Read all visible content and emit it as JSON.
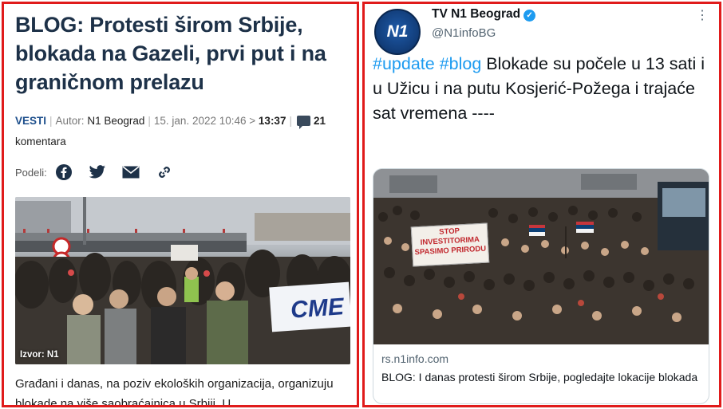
{
  "left": {
    "title": "BLOG: Protesti širom Srbije, blokada na Gazeli, prvi put i na graničnom prelazu",
    "meta": {
      "category": "VESTI",
      "author_label": "Autor:",
      "author": "N1 Beograd",
      "date": "15. jan. 2022 10:46 >",
      "updated": "13:37",
      "comments_count": "21",
      "comments_label": "komentara"
    },
    "share": {
      "label": "Podeli:",
      "icons": [
        "facebook-icon",
        "twitter-icon",
        "email-icon",
        "link-icon"
      ]
    },
    "photo": {
      "caption": "Izvor: N1",
      "banner_text": "CME",
      "sign_text": "80"
    },
    "lead": "Građani i danas, na poziv ekoloških organizacija, organizuju blokade na više saobraćajnica u Srbiji. U"
  },
  "right": {
    "account": {
      "avatar_text": "N1",
      "name": "TV N1 Beograd",
      "handle": "@N1infoBG"
    },
    "tweet": {
      "hashtag1": "#update",
      "hashtag2": "#blog",
      "body": "Blokade su počele u 13 sati i u Užicu i na putu Kosjerić-Požega i trajaće sat vremena ----"
    },
    "card": {
      "sign_text": "STOP INVESTITORIMA SPASIMO PRIRODU",
      "domain": "rs.n1info.com",
      "title": "BLOG: I danas protesti širom Srbije, pogledajte lokacije blokada"
    }
  },
  "colors": {
    "frame_red": "#e01b1b",
    "title_navy": "#1d3148",
    "hashtag_blue": "#1d9bf0",
    "verified_blue": "#1d9bf0"
  }
}
